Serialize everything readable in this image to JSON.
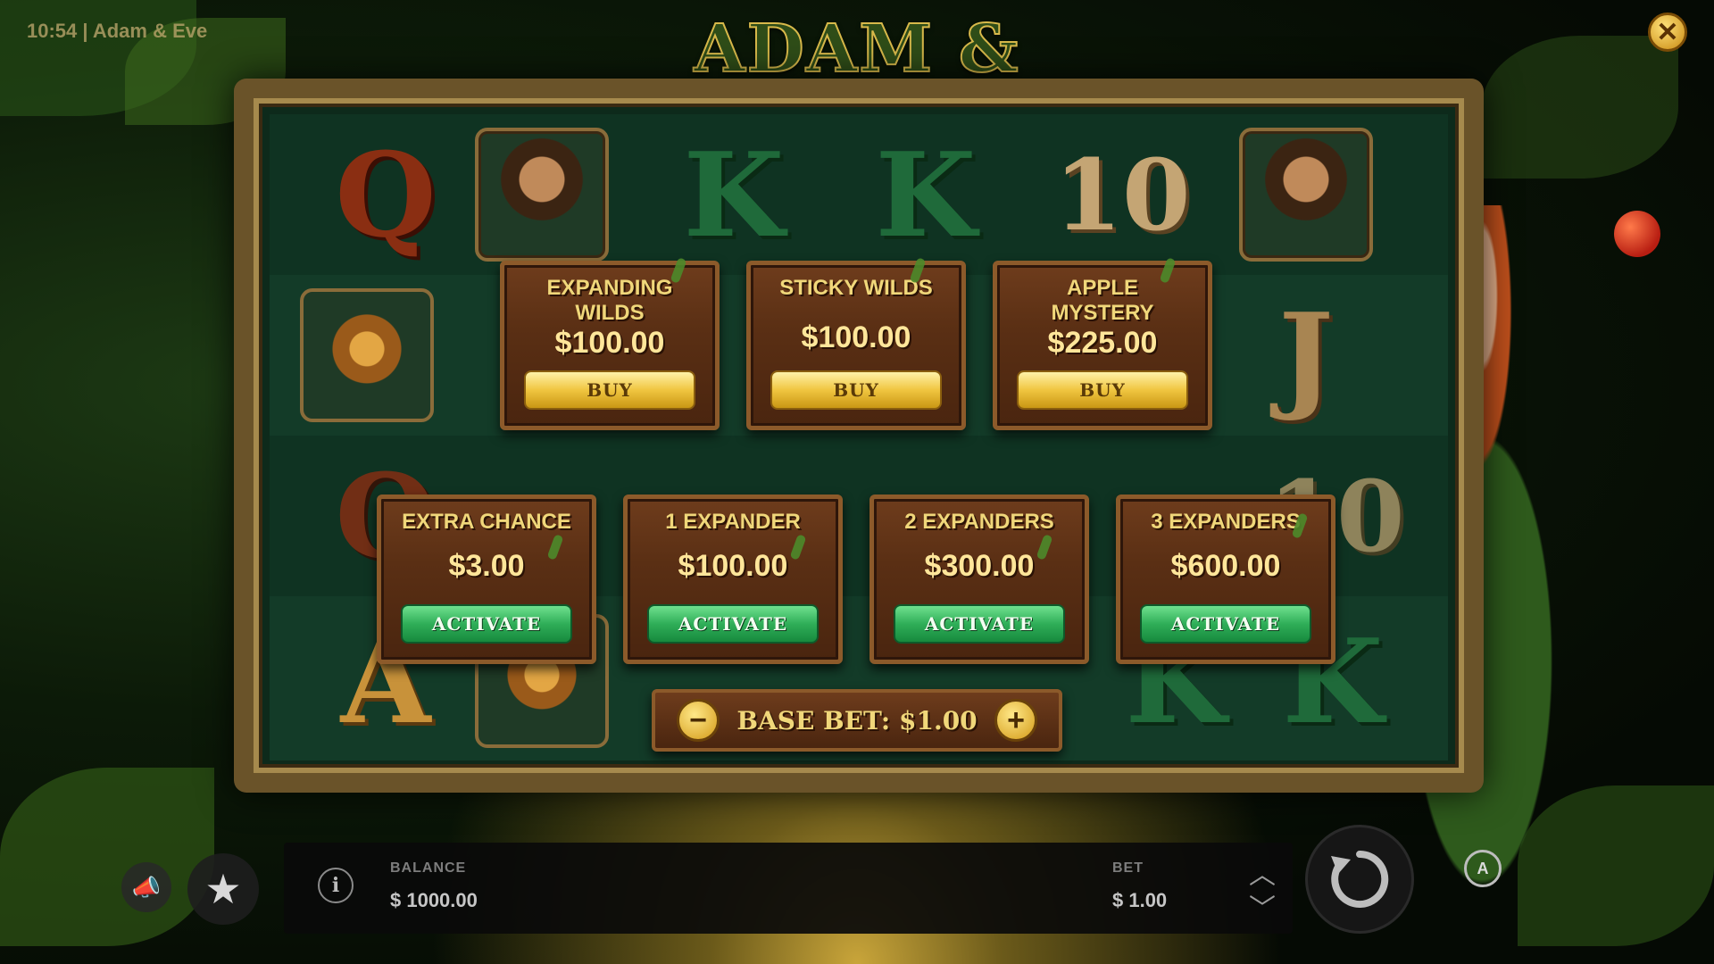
{
  "status": {
    "text": "10:54 | Adam & Eve"
  },
  "logo": {
    "text": "ADAM & EVE"
  },
  "close": {
    "glyph": "✕",
    "icon": "close-icon"
  },
  "reels": {
    "row1": [
      "Q",
      "adam-portrait",
      "K",
      "K",
      "10",
      "adam-portrait"
    ],
    "row2": [
      "lion",
      "",
      "",
      "",
      "",
      "J"
    ],
    "row3": [
      "Q",
      "",
      "",
      "",
      "",
      "10"
    ],
    "row4": [
      "A",
      "lion",
      "",
      "",
      "K",
      "K"
    ]
  },
  "feature_buy": [
    {
      "title": "EXPANDING WILDS",
      "price": "$100.00",
      "button": "BUY"
    },
    {
      "title": "STICKY WILDS",
      "price": "$100.00",
      "button": "BUY"
    },
    {
      "title": "APPLE MYSTERY",
      "price": "$225.00",
      "button": "BUY"
    }
  ],
  "feature_activate": [
    {
      "title": "EXTRA CHANCE",
      "price": "$3.00",
      "button": "ACTIVATE"
    },
    {
      "title": "1 EXPANDER",
      "price": "$100.00",
      "button": "ACTIVATE"
    },
    {
      "title": "2 EXPANDERS",
      "price": "$300.00",
      "button": "ACTIVATE"
    },
    {
      "title": "3 EXPANDERS",
      "price": "$600.00",
      "button": "ACTIVATE"
    }
  ],
  "base_bet": {
    "label": "BASE BET: $1.00",
    "minus": "−",
    "plus": "+"
  },
  "bottom": {
    "info_glyph": "i",
    "balance_label": "BALANCE",
    "balance_value": "$ 1000.00",
    "bet_label": "BET",
    "bet_value": "$ 1.00",
    "up_glyph": "︿",
    "down_glyph": "﹀",
    "autoplay_glyph": "A",
    "promo_glyph": "📣",
    "fav_glyph": "★"
  }
}
